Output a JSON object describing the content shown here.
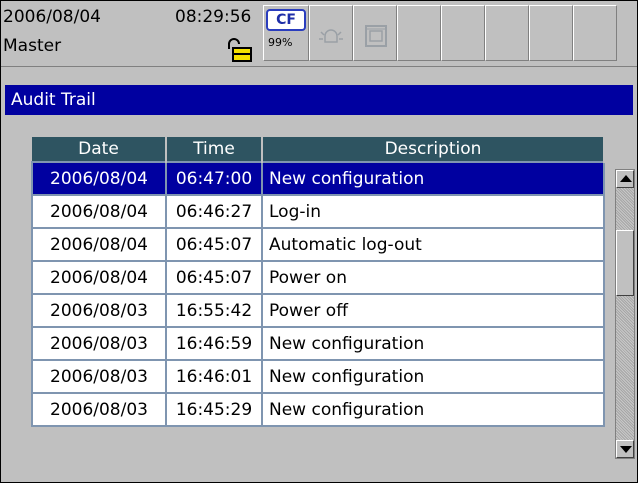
{
  "status": {
    "date": "2006/08/04",
    "time": "08:29:56",
    "user": "Master",
    "storage_label": "CF",
    "storage_percent": "99%"
  },
  "icons": {
    "lock": "lock-open-icon",
    "storage": "cf-card-icon",
    "alarm": "alarm-bell-icon",
    "display": "display-icon"
  },
  "colors": {
    "title_bg": "#0000a0",
    "header_bg": "#2e5461",
    "selected_bg": "#0000a0"
  },
  "screen": {
    "title": "Audit Trail"
  },
  "table": {
    "headers": [
      "Date",
      "Time",
      "Description"
    ],
    "rows": [
      {
        "date": "2006/08/04",
        "time": "06:47:00",
        "desc": "New configuration",
        "selected": true
      },
      {
        "date": "2006/08/04",
        "time": "06:46:27",
        "desc": "Log-in"
      },
      {
        "date": "2006/08/04",
        "time": "06:45:07",
        "desc": "Automatic log-out"
      },
      {
        "date": "2006/08/04",
        "time": "06:45:07",
        "desc": "Power on"
      },
      {
        "date": "2006/08/03",
        "time": "16:55:42",
        "desc": "Power off"
      },
      {
        "date": "2006/08/03",
        "time": "16:46:59",
        "desc": "New configuration"
      },
      {
        "date": "2006/08/03",
        "time": "16:46:01",
        "desc": "New configuration"
      },
      {
        "date": "2006/08/03",
        "time": "16:45:29",
        "desc": "New configuration"
      }
    ]
  }
}
